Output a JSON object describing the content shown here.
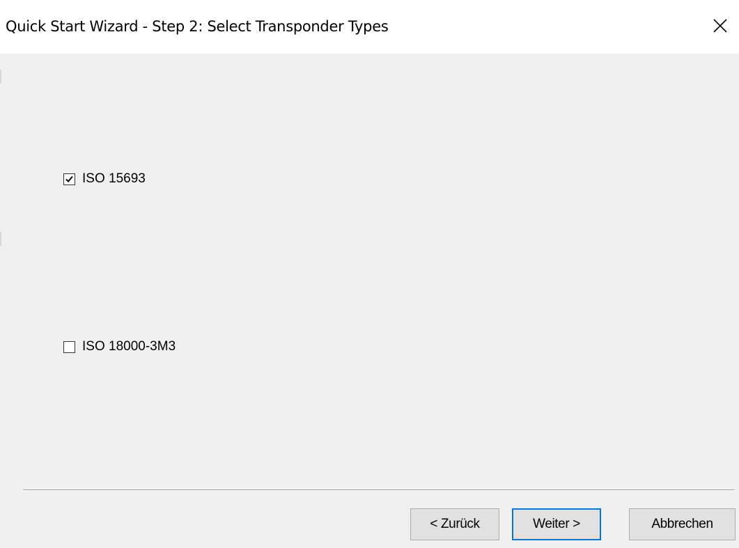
{
  "window": {
    "title": "Quick Start Wizard - Step 2: Select Transponder Types",
    "close_icon": "close-icon"
  },
  "options": [
    {
      "label": "ISO 15693",
      "checked": true
    },
    {
      "label": "ISO 18000-3M3",
      "checked": false
    }
  ],
  "buttons": {
    "back_label": "< Zurück",
    "next_label": "Weiter >",
    "cancel_label": "Abbrechen"
  },
  "colors": {
    "background": "#f0f0f0",
    "titlebar": "#ffffff",
    "button_face": "#e1e1e1",
    "default_button_border": "#0078d7"
  }
}
